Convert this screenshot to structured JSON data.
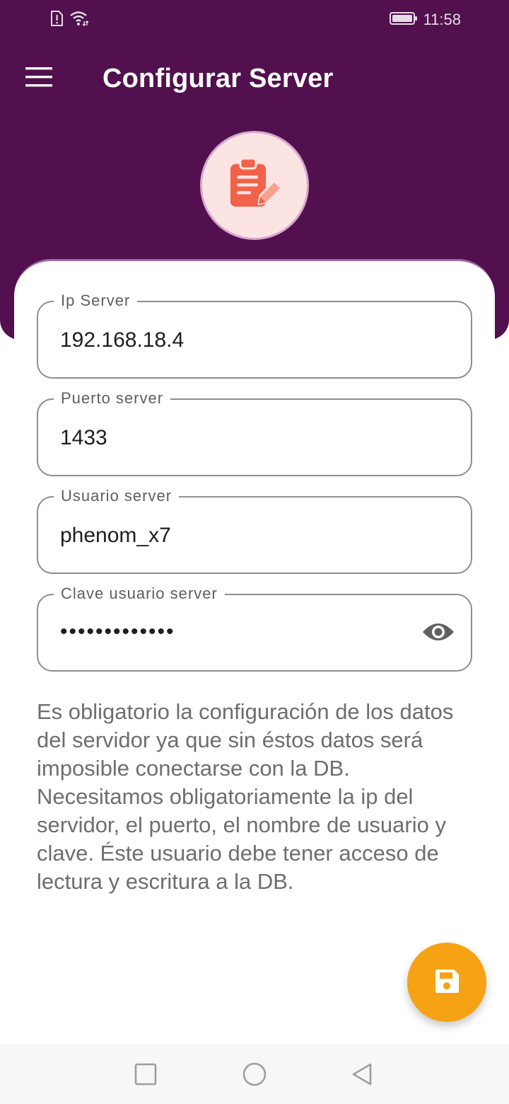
{
  "status_bar": {
    "time": "11:58",
    "icons": [
      "sim-alert-icon",
      "wifi-icon",
      "battery-icon"
    ]
  },
  "app_bar": {
    "title": "Configurar Server",
    "menu_icon": "menu-icon"
  },
  "header": {
    "logo_icon": "clipboard-edit-icon"
  },
  "form": {
    "fields": [
      {
        "label": "Ip Server",
        "value": "192.168.18.4"
      },
      {
        "label": "Puerto server",
        "value": "1433"
      },
      {
        "label": "Usuario server",
        "value": "phenom_x7"
      },
      {
        "label": "Clave usuario server",
        "value": "•••••••••••••",
        "type": "password",
        "toggle_icon": "eye-icon"
      }
    ],
    "info": "Es obligatorio la configuración de los datos del servidor ya que sin éstos datos será imposible conectarse con la DB. Necesitamos obligatoriamente la ip del servidor, el puerto, el nombre de usuario y clave. Éste usuario debe tener acceso de lectura y escritura a la DB."
  },
  "fab": {
    "icon": "save-icon"
  },
  "nav_bar": {
    "icons": [
      "recents-square-icon",
      "home-circle-icon",
      "back-triangle-icon"
    ]
  },
  "colors": {
    "primary": "#52104E",
    "accent": "#F5A314",
    "logo_bg": "#FCE4E3",
    "logo_icon": "#F26149"
  }
}
